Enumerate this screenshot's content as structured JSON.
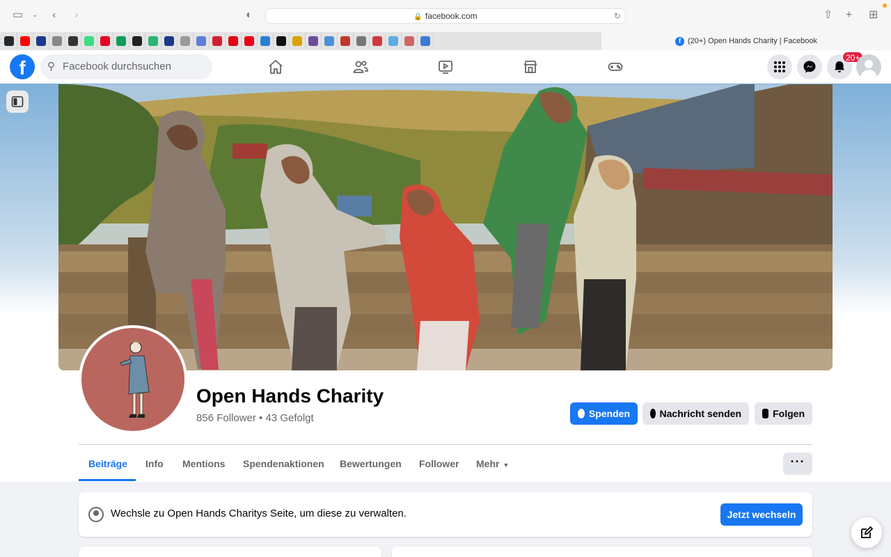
{
  "browser": {
    "url": "facebook.com",
    "active_tab_title": "(20+) Open Hands Charity | Facebook",
    "favorites": [
      {
        "icon": "github-icon",
        "color": "#24292e"
      },
      {
        "icon": "youtube-icon",
        "color": "#ff0000"
      },
      {
        "icon": "blue-dots-icon",
        "color": "#1b3c8c"
      },
      {
        "icon": "o-icon",
        "color": "#888888"
      },
      {
        "icon": "spiral-icon",
        "color": "#333333"
      },
      {
        "icon": "asterisk-icon",
        "color": "#3ddc84"
      },
      {
        "icon": "pinterest-icon",
        "color": "#e60023"
      },
      {
        "icon": "google-drive-icon",
        "color": "#0f9d58"
      },
      {
        "icon": "instagram-icon",
        "color": "#222222"
      },
      {
        "icon": "p-green-icon",
        "color": "#2bb673"
      },
      {
        "icon": "m-icon",
        "color": "#1a3a8a"
      },
      {
        "icon": "g-icon",
        "color": "#999999"
      },
      {
        "icon": "feather-icon",
        "color": "#5b7fd6"
      },
      {
        "icon": "k-red-icon",
        "color": "#d22030"
      },
      {
        "icon": "sparkasse-icon",
        "color": "#e30613"
      },
      {
        "icon": "db-icon",
        "color": "#ec0016"
      },
      {
        "icon": "translate-icon",
        "color": "#2a7fd4"
      },
      {
        "icon": "section-icon",
        "color": "#111111"
      },
      {
        "icon": "flag-icon",
        "color": "#d9a400"
      },
      {
        "icon": "eye-icon",
        "color": "#6a4c9c"
      },
      {
        "icon": "diamond-icon",
        "color": "#4a90d9"
      },
      {
        "icon": "figure-icon",
        "color": "#c0392b"
      },
      {
        "icon": "k-gray-icon",
        "color": "#777777"
      },
      {
        "icon": "wheel-icon",
        "color": "#d23a3a"
      },
      {
        "icon": "bubble-icon",
        "color": "#5dade2"
      },
      {
        "icon": "chart-icon",
        "color": "#cc6666"
      },
      {
        "icon": "cloud-icon",
        "color": "#3a7bd5"
      }
    ]
  },
  "fb_nav": {
    "search_placeholder": "Facebook durchsuchen",
    "notification_count": "20+"
  },
  "page": {
    "name": "Open Hands Charity",
    "stats": "856 Follower • 43 Gefolgt",
    "buttons": {
      "donate": "Spenden",
      "message": "Nachricht senden",
      "follow": "Folgen"
    },
    "tabs": [
      "Beiträge",
      "Info",
      "Mentions",
      "Spendenaktionen",
      "Bewertungen",
      "Follower",
      "Mehr"
    ],
    "more_menu": "···"
  },
  "switch_card": {
    "text": "Wechsle zu Open Hands Charitys Seite, um diese zu verwalten.",
    "button": "Jetzt wechseln"
  },
  "colors": {
    "fb_blue": "#1877f2",
    "badge_red": "#e41e3f"
  }
}
